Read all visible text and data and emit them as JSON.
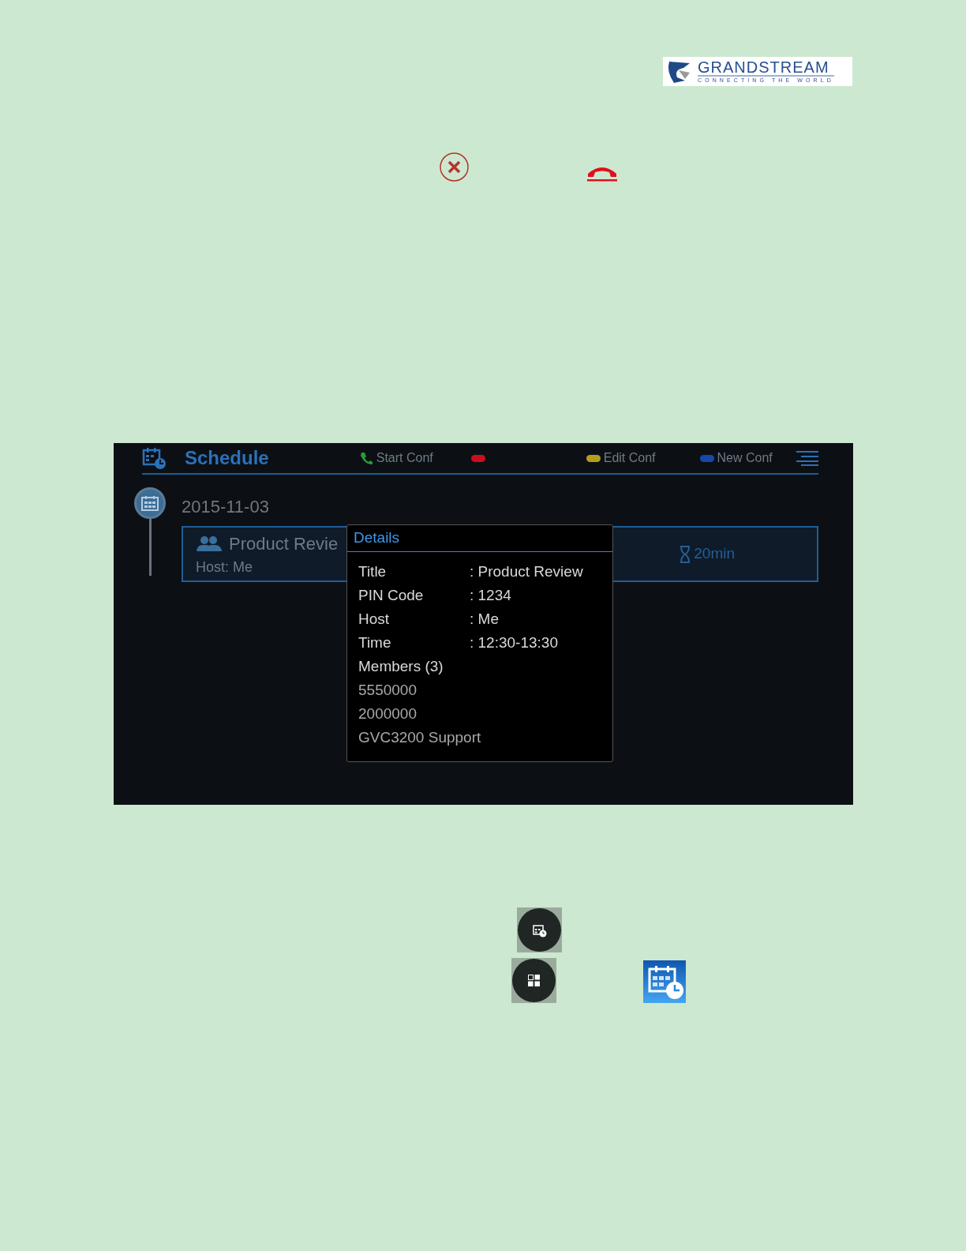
{
  "logo": {
    "name": "GRANDSTREAM",
    "tagline": "CONNECTING THE WORLD"
  },
  "screen": {
    "title": "Schedule",
    "softkeys": [
      {
        "kind": "phone",
        "label": "Start Conf"
      },
      {
        "kind": "pill",
        "color": "#c8101c"
      },
      {
        "kind": "pill",
        "color": "#b59d1c",
        "label": "Edit Conf"
      },
      {
        "kind": "pill",
        "color": "#1747a8",
        "label": "New Conf"
      }
    ],
    "date": "2015-11-03",
    "meeting": {
      "title": "Product Revie",
      "host": "Host: Me",
      "duration": "20min"
    },
    "dialog": {
      "title": "Details",
      "fields": [
        {
          "label": "Title",
          "value": ": Product Review"
        },
        {
          "label": "PIN Code",
          "value": ": 1234"
        },
        {
          "label": "Host",
          "value": ": Me"
        },
        {
          "label": "Time",
          "value": ": 12:30-13:30"
        }
      ],
      "members_heading": "Members (3)",
      "members": [
        "5550000",
        "2000000",
        "GVC3200 Support"
      ]
    }
  }
}
